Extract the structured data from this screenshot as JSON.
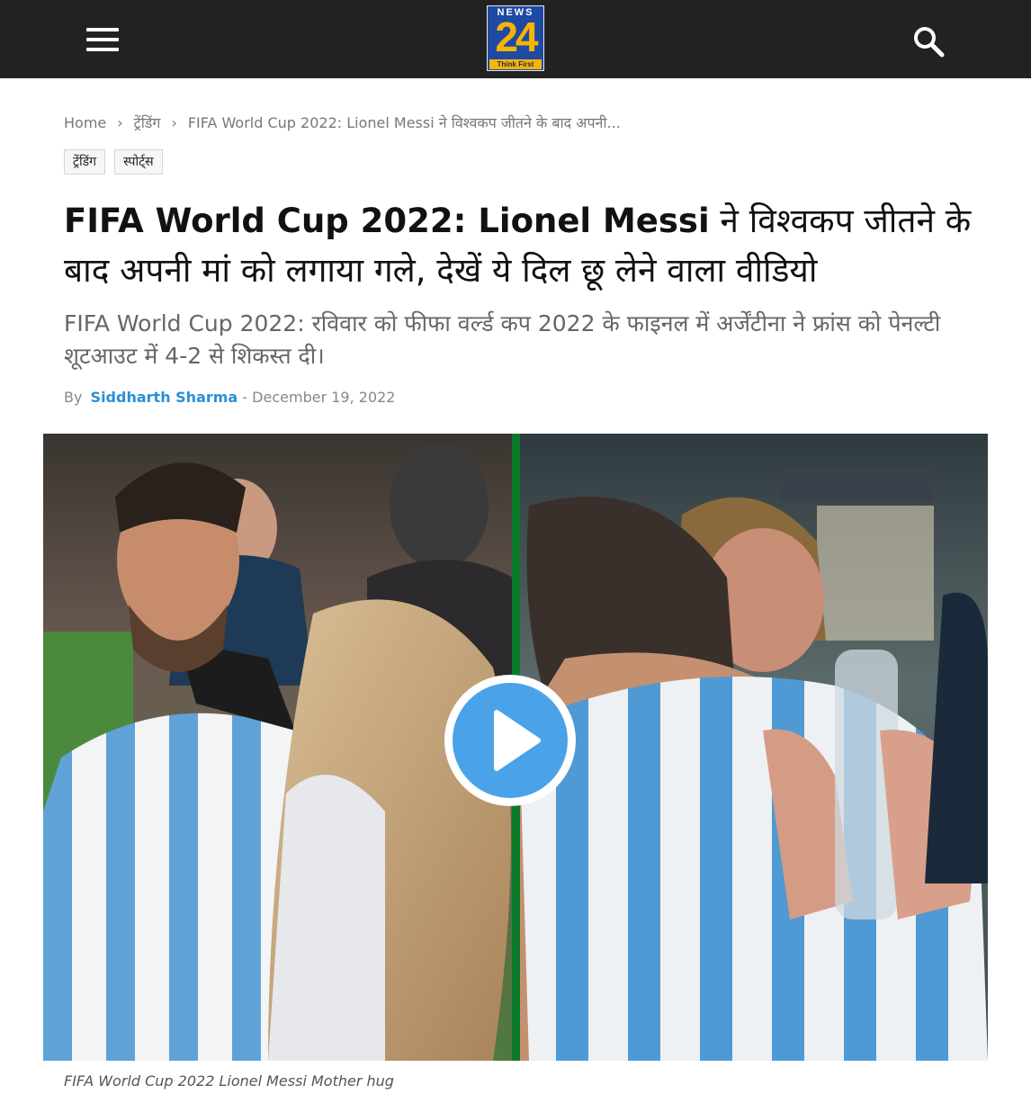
{
  "header": {
    "logo": {
      "top": "NEWS",
      "number": "24",
      "tagline": "Think First"
    },
    "colors": {
      "bar": "#222222",
      "logo_blue": "#1f4aa3",
      "logo_yellow": "#f7b500"
    }
  },
  "breadcrumb": {
    "home": "Home",
    "category": "ट्रेंडिंग",
    "current": "FIFA World Cup 2022: Lionel Messi ने विश्वकप जीतने के बाद अपनी..."
  },
  "tags": [
    "ट्रेंडिंग",
    "स्पोर्ट्स"
  ],
  "article": {
    "headline_bold": "FIFA World Cup 2022: Lionel Messi",
    "headline_rest": " ने विश्वकप जीतने के बाद अपनी मां को लगाया गले, देखें ये दिल छू लेने वाला वीडियो",
    "subheadline": "FIFA World Cup 2022: रविवार को फीफा वर्ल्ड कप 2022 के फाइनल में अर्जेंटीना ने फ्रांस को पेनल्टी शूटआउट में 4-2 से शिकस्त दी।",
    "by_label": "By",
    "author": "Siddharth Sharma",
    "date_sep": " - ",
    "date": "December 19, 2022"
  },
  "media": {
    "caption": "FIFA World Cup 2022 Lionel Messi Mother hug",
    "accent": "#4aa3e8"
  }
}
